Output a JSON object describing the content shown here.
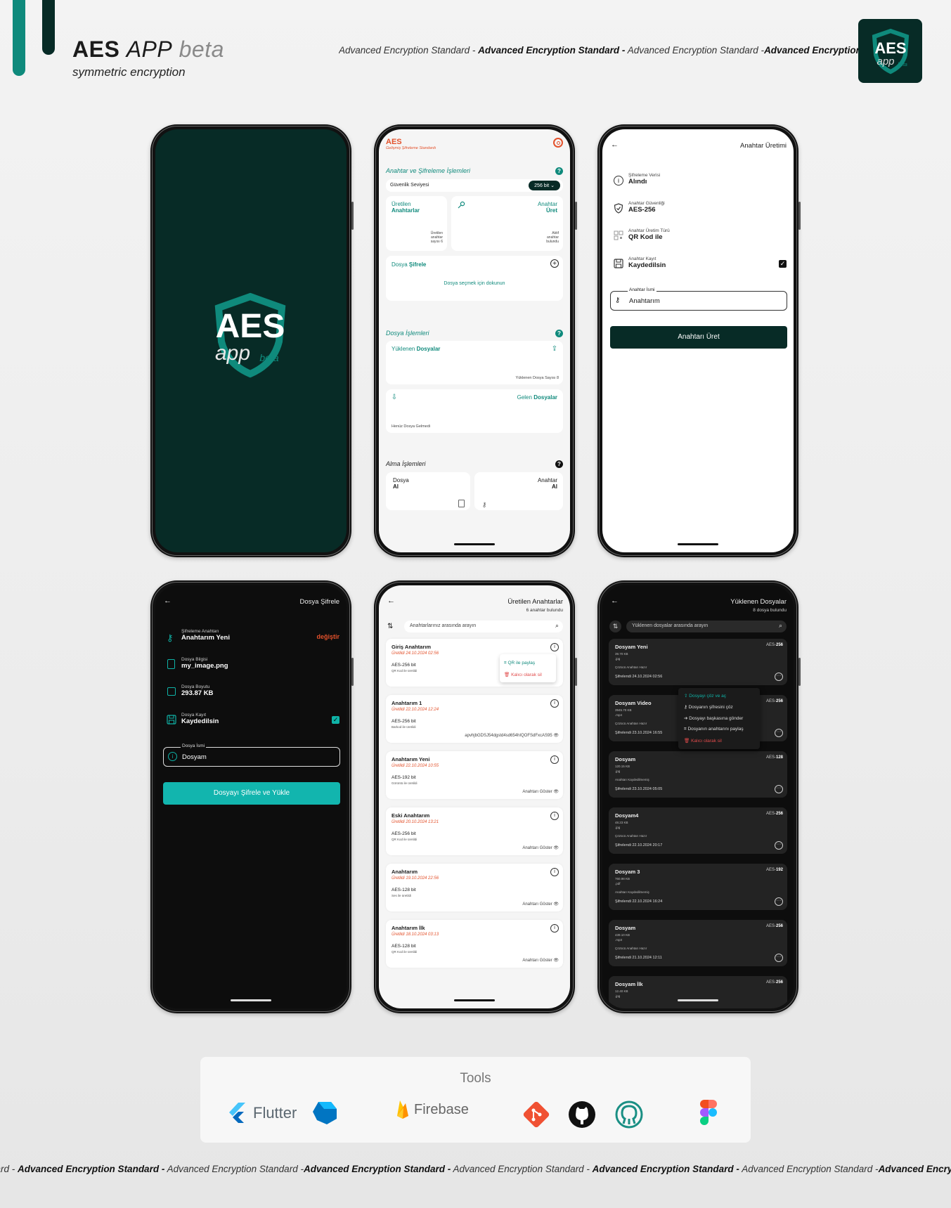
{
  "header": {
    "brand_aes": "AES",
    "brand_app": "APP",
    "brand_beta": "beta",
    "subtitle": "symmetric encryption",
    "marquee": [
      "Advanced Encryption Standard -",
      "Advanced Encryption Standard -",
      "Advanced Encryption Standard -",
      "Advanced Encryption"
    ],
    "logo": {
      "aes": "AES",
      "app": "app",
      "beta": "beta"
    }
  },
  "splash": {
    "aes": "AES",
    "app": "app",
    "beta": "beta"
  },
  "home": {
    "brand": "AES",
    "brand_sub": "Gelişmiş Şifreleme Standardı",
    "section_keys": "Anahtar ve Şifreleme İşlemleri",
    "security_label": "Güvenlik Seviyesi",
    "security_value": "256 bit",
    "produced_title1": "Üretilen",
    "produced_title2": "Anahtarlar",
    "produced_count": "Üretilen anahtar sayısı 6",
    "generate_title1": "Anahtar",
    "generate_title2": "Üret",
    "generate_sub": "Aktif anahtar bulundu",
    "encrypt_title1": "Dosya",
    "encrypt_title2": "Şifrele",
    "encrypt_hint": "Dosya seçmek için dokunun",
    "section_files": "Dosya İşlemleri",
    "uploaded_title1": "Yüklenen",
    "uploaded_title2": "Dosyalar",
    "uploaded_count": "Yüklenen Dosya Sayısı 8",
    "incoming_title1": "Gelen",
    "incoming_title2": "Dosyalar",
    "incoming_empty": "Henüz Dosya Gelmedi",
    "section_receive": "Alma İşlemleri",
    "recv_file1": "Dosya",
    "recv_file2": "Al",
    "recv_key1": "Anahtar",
    "recv_key2": "Al",
    "help": "?"
  },
  "keygen": {
    "title": "Anahtar Üretimi",
    "items": [
      {
        "label": "Şifreleme Verisi",
        "value": "Alındı"
      },
      {
        "label": "Anahtar Güvenliği",
        "value": "AES-256"
      },
      {
        "label": "Anahtar Üretim Türü",
        "value": "QR Kod ile"
      },
      {
        "label": "Anahtar Kayıt",
        "value": "Kaydedilsin"
      }
    ],
    "field_label": "Anahtar İsmi",
    "field_value": "Anahtarım",
    "button": "Anahtarı Üret"
  },
  "encrypt": {
    "title": "Dosya Şifrele",
    "items": [
      {
        "label": "Şifreleme Anahtarı",
        "value": "Anahtarım Yeni"
      },
      {
        "label": "Dosya Bilgisi",
        "value": "my_image.png"
      },
      {
        "label": "Dosya Boyutu",
        "value": "293.87 KB"
      },
      {
        "label": "Dosya Kayıt",
        "value": "Kaydedilsin"
      }
    ],
    "change": "değiştir",
    "field_label": "Dosya İsmi",
    "field_value": "Dosyam",
    "button": "Dosyayı Şifrele ve Yükle"
  },
  "keys": {
    "title": "Üretilen Anahtarlar",
    "count": "6 anahtar bulundu",
    "search_placeholder": "Anahtarlarınız arasında arayın",
    "popup": {
      "share": "QR ile paylaş",
      "delete": "Kalıcı olarak sil"
    },
    "items": [
      {
        "name": "Giriş Anahtarım",
        "date": "Üretildi 24.10.2024 02:56",
        "bits": "AES-256 bit",
        "method": "QR Kod ile üretildi",
        "action": ""
      },
      {
        "name": "Anahtarım 1",
        "date": "Üretildi 22.10.2024 12:24",
        "bits": "AES-256 bit",
        "method": "Barkod ile üretildi",
        "action": "apvhjbGDSJ54dgstd4sd654hIQOFSdFxcAS95"
      },
      {
        "name": "Anahtarım Yeni",
        "date": "Üretildi 22.10.2024 10:55",
        "bits": "AES-192 bit",
        "method": "Görüntü ile üretildi",
        "action": "Anahtarı Göster"
      },
      {
        "name": "Eski Anahtarım",
        "date": "Üretildi 20.10.2024 13:21",
        "bits": "AES-256 bit",
        "method": "QR Kod ile üretildi",
        "action": "Anahtarı Göster"
      },
      {
        "name": "Anahtarım",
        "date": "Üretildi 19.10.2024 22:56",
        "bits": "AES-128 bit",
        "method": "Ses ile üretildi",
        "action": "Anahtarı Göster"
      },
      {
        "name": "Anahtarım İlk",
        "date": "Üretildi 18.10.2024 03:13",
        "bits": "AES-128 bit",
        "method": "QR Kod ile üretildi",
        "action": "Anahtarı Göster"
      }
    ]
  },
  "files": {
    "title": "Yüklenen Dosyalar",
    "count": "8 dosya bulundu",
    "search_placeholder": "Yüklenen dosyalar arasında arayın",
    "menu": [
      "Dosyayı çöz ve aç",
      "Dosyanın şifresini çöz",
      "Dosyayı başkasına gönder",
      "Dosyanın anahtarını paylaş",
      "Kalıcı olarak sil"
    ],
    "items": [
      {
        "name": "Dosyam Yeni",
        "size": "39.70 KB",
        "ext": ".jpg",
        "status": "Çözücü Anahtarı Hazır",
        "date": "Şifrelendi 24.10.2024 02:56",
        "aes": "AES-",
        "bits": "256"
      },
      {
        "name": "Dosyam Video",
        "size": "3945.70 KB",
        "ext": ".mp4",
        "status": "Çözücü Anahtarı Hazır",
        "date": "Şifrelendi 23.10.2024 16:55",
        "aes": "AES-",
        "bits": "256"
      },
      {
        "name": "Dosyam",
        "size": "120.15 KB",
        "ext": ".jpg",
        "status": "Anahtarı Kaydedilmemiş",
        "date": "Şifrelendi 23.10.2024 05:05",
        "aes": "AES-",
        "bits": "128"
      },
      {
        "name": "Dosyam4",
        "size": "48.23 KB",
        "ext": ".jpg",
        "status": "Çözücü Anahtarı Hazır",
        "date": "Şifrelendi 22.10.2024 20:17",
        "aes": "AES-",
        "bits": "256"
      },
      {
        "name": "Dosyam 3",
        "size": "760.98 KB",
        "ext": ".pdf",
        "status": "Anahtarı Kaydedilmemiş",
        "date": "Şifrelendi 22.10.2024 16:24",
        "aes": "AES-",
        "bits": "192"
      },
      {
        "name": "Dosyam",
        "size": "439.10 KB",
        "ext": ".mp3",
        "status": "Çözücü Anahtarı Hazır",
        "date": "Şifrelendi 21.10.2024 12:11",
        "aes": "AES-",
        "bits": "256"
      },
      {
        "name": "Dosyam İlk",
        "size": "12.40 KB",
        "ext": ".jpg",
        "status": "",
        "date": "",
        "aes": "AES-",
        "bits": "256"
      }
    ]
  },
  "tools": {
    "title": "Tools",
    "flutter": "Flutter",
    "firebase": "Firebase"
  }
}
